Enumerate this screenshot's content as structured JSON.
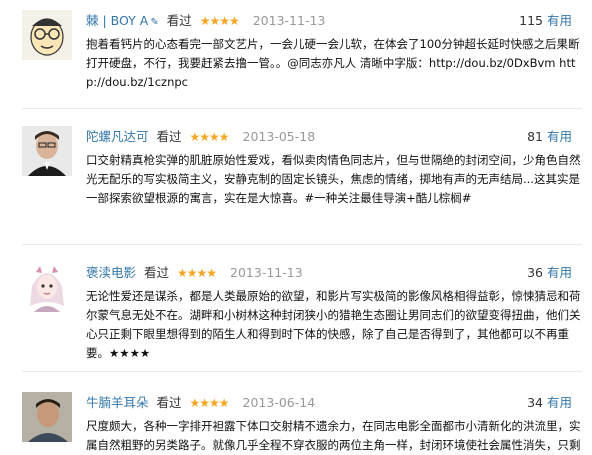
{
  "reviews": [
    {
      "username": "棘 | BOY A",
      "seen_label": "看过",
      "stars": "★★★★",
      "date": "2013-11-13",
      "useful_count": "115",
      "useful_label": "有用",
      "text": "抱着看钙片的心态看完一部文艺片，一会儿硬一会儿软，在体会了100分钟超长延时快感之后果断打开硬盘，不行，我要赶紧去撸一管。。@同志亦凡人 清晰中字版：http://dou.bz/0DxBvm http://dou.bz/1cznpc"
    },
    {
      "username": "陀螺凡达可",
      "seen_label": "看过",
      "stars": "★★★★",
      "date": "2013-05-18",
      "useful_count": "81",
      "useful_label": "有用",
      "text": "口交射精真枪实弹的肌脏原始性爱戏，看似卖肉情色同志片，但与世隔绝的封闭空间，少角色自然光无配乐的写实极简主义，安静克制的固定长镜头，焦虑的情绪，掷地有声的无声结局...这其实是一部探索欲望根源的寓言，实在是大惊喜。#一种关注最佳导演+酷儿棕榈#"
    },
    {
      "username": "褒渎电影",
      "seen_label": "看过",
      "stars": "★★★★",
      "date": "2013-11-13",
      "useful_count": "36",
      "useful_label": "有用",
      "text": "无论性爱还是谋杀，都是人类最原始的欲望，和影片写实极简的影像风格相得益彰，惊悚猜忌和荷尔蒙气息无处不在。湖畔和小树林这种封闭狭小的猎艳生态圈让男同志们的欲望变得扭曲，他们关心只正剩下眼里想得到的陌生人和得到时下体的快感，除了自己是否得到了，其他都可以不再重要。★★★★"
    },
    {
      "username": "牛腩羊耳朵",
      "seen_label": "看过",
      "stars": "★★★★",
      "date": "2013-06-14",
      "useful_count": "34",
      "useful_label": "有用",
      "text": "尺度颇大，各种一字排开袒露下体口交射精不遗余力，在同志电影全面都市小清新化的洪流里，实属自然粗野的另类路子。就像几乎全程不穿衣服的两位主角一样，封闭环境使社会属性消失，只剩"
    }
  ]
}
